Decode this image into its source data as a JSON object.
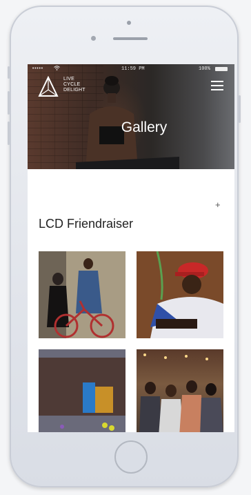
{
  "status_bar": {
    "signal": "•••••",
    "time": "11:59 PM",
    "battery": "100%"
  },
  "brand": {
    "line1": "LIVE",
    "line2": "CYCLE",
    "line3": "DELIGHT"
  },
  "header": {
    "title": "Gallery",
    "menu_icon": "hamburger-menu-icon"
  },
  "section": {
    "title": "LCD Friendraiser",
    "add_icon": "plus-icon"
  },
  "gallery": {
    "items": [
      {
        "description": "photo-1"
      },
      {
        "description": "photo-2"
      },
      {
        "description": "photo-3"
      },
      {
        "description": "photo-4"
      }
    ]
  },
  "colors": {
    "device_frame": "#dfe2e8",
    "screen_bg": "#ffffff",
    "title_text": "#222222"
  }
}
